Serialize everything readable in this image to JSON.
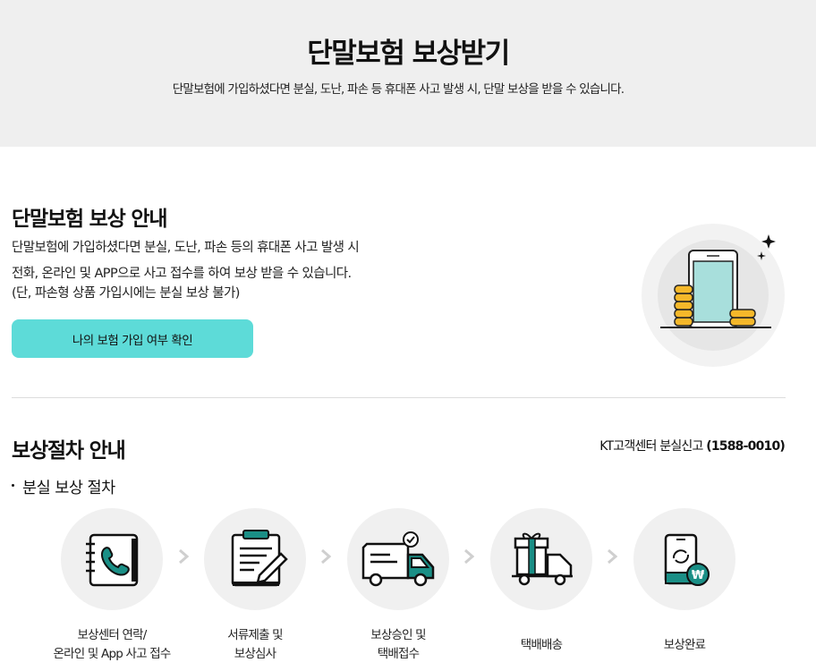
{
  "hero": {
    "title": "단말보험 보상받기",
    "desc": "단말보험에 가입하셨다면 분실, 도난, 파손 등 휴대폰 사고 발생 시, 단말 보상을 받을 수 있습니다."
  },
  "guide": {
    "title": "단말보험 보상 안내",
    "line1": "단말보험에 가입하셨다면 분실, 도난, 파손 등의 휴대폰 사고 발생 시",
    "line2": "전화, 온라인 및 APP으로 사고 접수를 하여 보상 받을 수 있습니다.",
    "note": "(단, 파손형 상품 가입시에는 분실 보상 불가)",
    "button": "나의 보험 가입 여부 확인"
  },
  "process": {
    "title": "보상절차 안내",
    "call_label": "KT고객센터 분실신고 ",
    "call_number": "(1588-0010)",
    "sub_title": "분실 보상 절차",
    "steps": [
      {
        "icon": "phone-book-icon",
        "line1": "보상센터 연락/",
        "line2": "온라인 및 App 사고 접수"
      },
      {
        "icon": "clipboard-pen-icon",
        "line1": "서류제출 및",
        "line2": "보상심사"
      },
      {
        "icon": "delivery-truck-icon",
        "line1": "보상승인 및",
        "line2": "택배접수"
      },
      {
        "icon": "gift-truck-icon",
        "line1": "택배배송",
        "line2": ""
      },
      {
        "icon": "phone-won-icon",
        "line1": "보상완료",
        "line2": ""
      }
    ]
  },
  "colors": {
    "accent": "#5ddbd8",
    "teal": "#1a8f86",
    "gold": "#f5b82a",
    "hero_bg": "#efefef"
  }
}
